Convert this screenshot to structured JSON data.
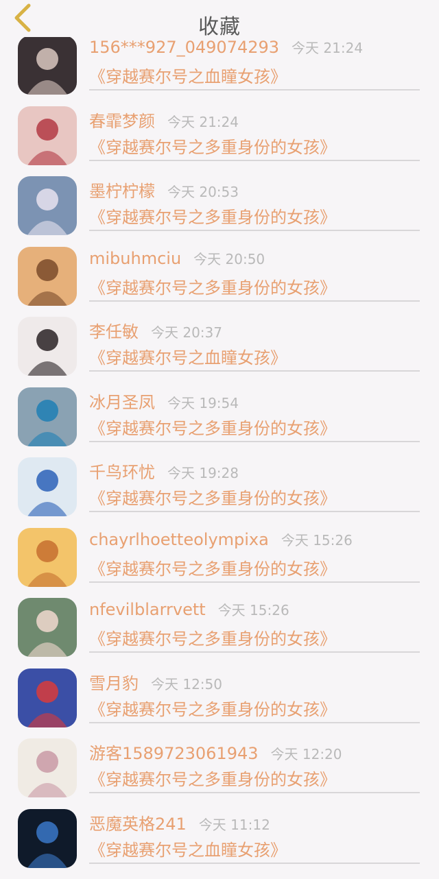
{
  "header": {
    "title": "收藏",
    "back_icon": "chevron-left-icon",
    "accent": "#d8b245"
  },
  "items": [
    {
      "name": "156***927_049074293",
      "time": "今天 21:24",
      "book": "《穿越赛尔号之血瞳女孩》",
      "bg": "#3a3134",
      "fg": "#d9c7c0"
    },
    {
      "name": "春霏梦颜",
      "time": "今天 21:24",
      "book": "《穿越赛尔号之多重身份的女孩》",
      "bg": "#e8c6c2",
      "fg": "#b33a44"
    },
    {
      "name": "墨柠柠檬",
      "time": "今天 20:53",
      "book": "《穿越赛尔号之多重身份的女孩》",
      "bg": "#7c93b3",
      "fg": "#e8e2ee"
    },
    {
      "name": "mibuhmciu",
      "time": "今天 20:50",
      "book": "《穿越赛尔号之多重身份的女孩》",
      "bg": "#e6b07a",
      "fg": "#7a4b2a"
    },
    {
      "name": "李任敏",
      "time": "今天 20:37",
      "book": "《穿越赛尔号之血瞳女孩》",
      "bg": "#efeaea",
      "fg": "#2a2326"
    },
    {
      "name": "冰月圣凤",
      "time": "今天 19:54",
      "book": "《穿越赛尔号之多重身份的女孩》",
      "bg": "#8aa2b3",
      "fg": "#1e7fb4"
    },
    {
      "name": "千鸟环忧",
      "time": "今天 19:28",
      "book": "《穿越赛尔号之多重身份的女孩》",
      "bg": "#dfe9f2",
      "fg": "#2d62b8"
    },
    {
      "name": "chayrlhoetteolympixa",
      "time": "今天 15:26",
      "book": "《穿越赛尔号之多重身份的女孩》",
      "bg": "#f3c46a",
      "fg": "#c5702f"
    },
    {
      "name": "nfevilblarrvett",
      "time": "今天 15:26",
      "book": "《穿越赛尔号之多重身份的女孩》",
      "bg": "#6f8a6f",
      "fg": "#f1d8cf"
    },
    {
      "name": "雪月豹",
      "time": "今天 12:50",
      "book": "《穿越赛尔号之多重身份的女孩》",
      "bg": "#3b4fa6",
      "fg": "#d93b3b"
    },
    {
      "name": "游客1589723061943",
      "time": "今天 12:20",
      "book": "《穿越赛尔号之多重身份的女孩》",
      "bg": "#f0ebe4",
      "fg": "#c99aa6"
    },
    {
      "name": "恶魔英格241",
      "time": "今天 11:12",
      "book": "《穿越赛尔号之血瞳女孩》",
      "bg": "#0f1a2a",
      "fg": "#3a78c8"
    }
  ]
}
